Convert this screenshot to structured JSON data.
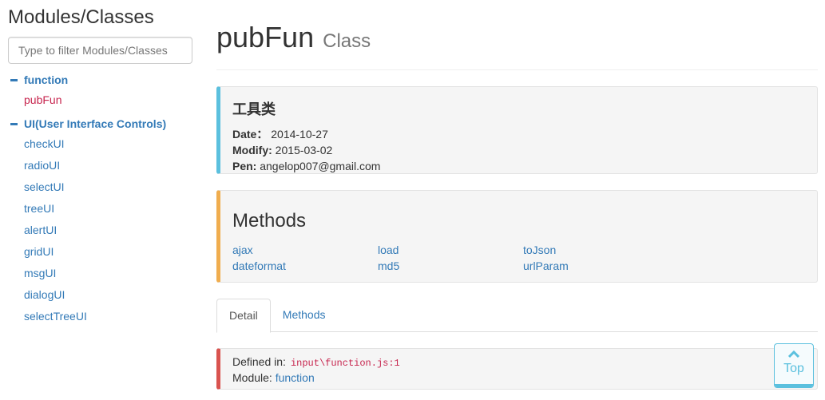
{
  "sidebar": {
    "title": "Modules/Classes",
    "filter_placeholder": "Type to filter Modules/Classes",
    "groups": [
      {
        "label": "function",
        "items": [
          "pubFun"
        ]
      },
      {
        "label": "UI(User Interface Controls)",
        "items": [
          "checkUI",
          "radioUI",
          "selectUI",
          "treeUI",
          "alertUI",
          "gridUI",
          "msgUI",
          "dialogUI",
          "selectTreeUI"
        ]
      }
    ],
    "active_item": "pubFun"
  },
  "header": {
    "title": "pubFun",
    "subtitle": "Class"
  },
  "info": {
    "heading": "工具类",
    "date_label": "Date：",
    "date_value": "2014-10-27",
    "modify_label": "Modify:",
    "modify_value": "2015-03-02",
    "pen_label": "Pen:",
    "pen_value": "angelop007@gmail.com"
  },
  "methods": {
    "heading": "Methods",
    "items": [
      "ajax",
      "load",
      "toJson",
      "dateformat",
      "md5",
      "urlParam"
    ]
  },
  "tabs": [
    {
      "label": "Detail",
      "active": true
    },
    {
      "label": "Methods",
      "active": false
    }
  ],
  "defined": {
    "defined_label": "Defined in:",
    "defined_value": "input\\function.js:1",
    "module_label": "Module:",
    "module_value": "function"
  },
  "top_button": {
    "label": "Top",
    "icon": "chevron-up-icon"
  },
  "colors": {
    "link": "#337ab7",
    "active_link": "#c7254e",
    "info_border": "#5bc0de",
    "methods_border": "#f0ad4e",
    "defined_border": "#d9534f"
  }
}
